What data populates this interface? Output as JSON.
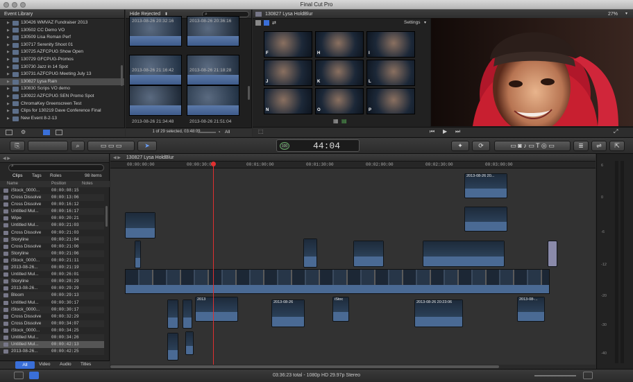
{
  "window": {
    "title": "Final Cut Pro"
  },
  "event_library": {
    "title": "Event Library",
    "items": [
      "130426 WMVAZ Fundraiser 2013",
      "130502 CC Demo VO",
      "130509 Lisa Roman Perf",
      "130717 Serenity Shoot 01",
      "130725 AZFCPUG Show Open",
      "130729 GFCPUG-Promos",
      "130730 Jazz in 14 Spot",
      "130731 AZFCPUG Meeting July 13",
      "130827 Lysa Rain",
      "130830 Scrips VO demo",
      "130922 AZFCPUG SEN Promo Spot",
      "ChromaKey Greenscreen Test",
      "Clips for 130219 Dave Conference Final",
      "New Event 8-2-13"
    ],
    "selected_index": 8
  },
  "browser": {
    "filter": "Hide Rejected",
    "clips": [
      {
        "date": "2013-08-26 20:32:16"
      },
      {
        "date": "2013-08-26 20:36:16"
      },
      {
        "date": "2013-08-26 21:16:42"
      },
      {
        "date": "2013-08-26 21:18:28"
      },
      {
        "date": "2013-08-26 21:34:48"
      },
      {
        "date": "2013-08-26 21:51:04"
      }
    ],
    "selection_status": "1 of 29 selected, 03:48:09",
    "filter_all": "All"
  },
  "viewer": {
    "title": "130827 Lysa HoldBlur",
    "zoom": "27%",
    "settings": "Settings",
    "thumbs": [
      "F",
      "H",
      "I",
      "J",
      "K",
      "L",
      "N",
      "O",
      "P"
    ]
  },
  "toolbar": {
    "timecode": "44:04",
    "timecode_prefix": "100"
  },
  "timeline_index": {
    "project": "130827 Lysa HoldBlur",
    "tabs": [
      "Clips",
      "Tags",
      "Roles"
    ],
    "item_count": "98 items",
    "columns": [
      "Name",
      "Position",
      "Notes"
    ],
    "rows": [
      [
        "iStock_0000...",
        "00:00:08:15"
      ],
      [
        "Cross Dissolve",
        "00:00:13:06"
      ],
      [
        "Cross Dissolve",
        "00:00:16:12"
      ],
      [
        "Untitled Mul...",
        "00:00:16:17"
      ],
      [
        "Wipe",
        "00:00:20:21"
      ],
      [
        "Untitled Mul...",
        "00:00:21:03"
      ],
      [
        "Cross Dissolve",
        "00:00:21:03"
      ],
      [
        "Storyline",
        "00:00:21:04"
      ],
      [
        "Cross Dissolve",
        "00:00:21:06"
      ],
      [
        "Storyline",
        "00:00:21:06"
      ],
      [
        "iStock_0000...",
        "00:00:21:11"
      ],
      [
        "2013-08-26...",
        "00:00:21:19"
      ],
      [
        "Untitled Mul...",
        "00:00:26:01"
      ],
      [
        "Storyline",
        "00:00:28:29"
      ],
      [
        "2013-08-26...",
        "00:00:29:29"
      ],
      [
        "Bloom",
        "00:00:29:13"
      ],
      [
        "Untitled Mul...",
        "00:00:30:17"
      ],
      [
        "iStock_0000...",
        "00:00:30:17"
      ],
      [
        "Cross Dissolve",
        "00:00:32:29"
      ],
      [
        "Cross Dissolve",
        "00:00:34:07"
      ],
      [
        "iStock_0000...",
        "00:00:34:25"
      ],
      [
        "Untitled Mul...",
        "00:00:34:26"
      ],
      [
        "Untitled Mul...",
        "00:00:42:13"
      ],
      [
        "2013-08-26...",
        "00:00:42:25"
      ]
    ],
    "selected_row": 22,
    "bottom_tabs": [
      "All",
      "Video",
      "Audio",
      "Titles"
    ]
  },
  "timeline": {
    "ruler": [
      "00:00:00:00",
      "00:00:30:00",
      "00:01:00:00",
      "00:01:30:00",
      "00:02:00:00",
      "00:02:30:00",
      "00:03:00:00"
    ],
    "labels": [
      "2013-08-26 20...",
      "2013-08-26 20:2",
      "2013-08-26 20:23:06",
      "2013-08-26",
      "2013-08-26",
      "2013",
      "2013-08-...",
      "Blo...",
      "iStoc"
    ]
  },
  "meters": [
    "6",
    "0",
    "-6",
    "-12",
    "-20",
    "-30",
    "-40"
  ],
  "status": {
    "text": "03:36:23 total - 1080p HD 29.97p Stereo"
  }
}
